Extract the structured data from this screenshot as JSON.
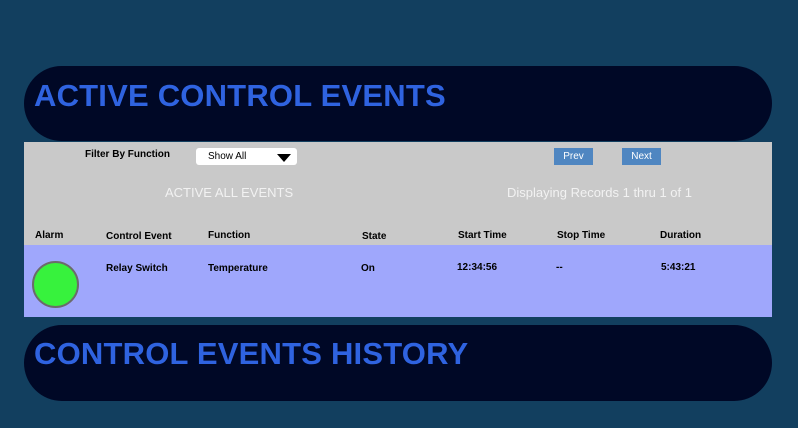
{
  "active_banner": {
    "title": "ACTIVE CONTROL EVENTS"
  },
  "toolbar": {
    "filter_label": "Filter By Function",
    "filter_value": "Show All",
    "prev_label": "Prev",
    "next_label": "Next"
  },
  "summary": {
    "heading": "ACTIVE ALL EVENTS",
    "records": "Displaying Records 1 thru 1 of 1"
  },
  "table": {
    "columns": [
      "Alarm",
      "Control Event",
      "Function",
      "State",
      "Start Time",
      "Stop Time",
      "Duration"
    ],
    "rows": [
      {
        "alarm_status": "active",
        "alarm_color": "#37f23d",
        "control_event": "Relay Switch",
        "function": "Temperature",
        "state": "On",
        "start_time": "12:34:56",
        "stop_time": "--",
        "duration": "5:43:21"
      }
    ]
  },
  "history_banner": {
    "title": "CONTROL EVENTS HISTORY"
  },
  "icons": {
    "filter_dropdown": "chevron-down-icon",
    "alarm_indicator": "alarm-status-icon"
  },
  "colors": {
    "background": "#123f5f",
    "banner": "#000826",
    "banner_text": "#2f63e0",
    "panel": "#c9c9c9",
    "row": "#9fa7fc",
    "button": "#4f86c1"
  }
}
